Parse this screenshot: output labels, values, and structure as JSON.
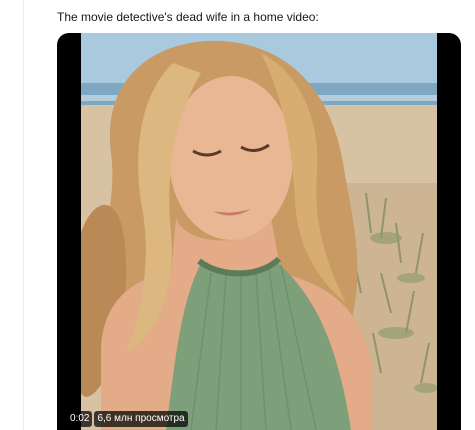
{
  "tweet": {
    "text": "The movie detective's dead wife in a home video:"
  },
  "video": {
    "time": "0:02",
    "views": "6,6 млн просмотра",
    "accent": "#000000"
  },
  "colors": {
    "sky": "#9fc3db",
    "sea": "#7fa9c4",
    "sand": "#d8c3a5",
    "dress": "#7fa37a",
    "hair": "#d9b27d",
    "skin": "#e9b492"
  }
}
